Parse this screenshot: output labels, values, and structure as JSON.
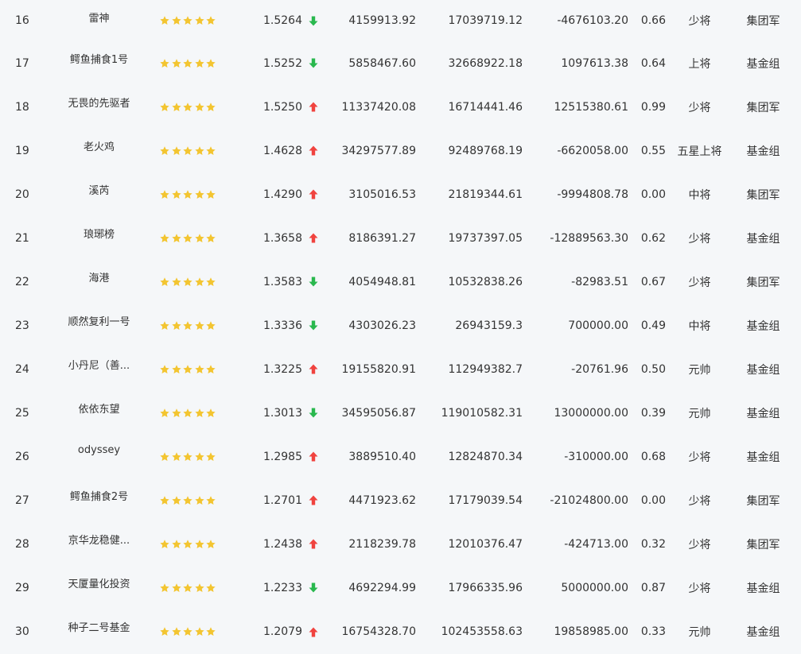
{
  "colors": {
    "star": "#f3c531",
    "arrow_up": "#f0433f",
    "arrow_down": "#29b84e",
    "background": "#f5f7f9",
    "text": "#333333"
  },
  "icons": {
    "rating": "star-icon",
    "up": "arrow-up-icon",
    "down": "arrow-down-icon"
  },
  "rows": [
    {
      "rank": "16",
      "name": "雷神",
      "stars": 5,
      "value": "1.5264",
      "trend": "down",
      "amount1": "4159913.92",
      "amount2": "17039719.12",
      "amount3": "-4676103.20",
      "ratio": "0.66",
      "level": "少将",
      "group": "集团军"
    },
    {
      "rank": "17",
      "name": "鳄鱼捕食1号",
      "stars": 5,
      "value": "1.5252",
      "trend": "down",
      "amount1": "5858467.60",
      "amount2": "32668922.18",
      "amount3": "1097613.38",
      "ratio": "0.64",
      "level": "上将",
      "group": "基金组"
    },
    {
      "rank": "18",
      "name": "无畏的先驱者",
      "stars": 5,
      "value": "1.5250",
      "trend": "up",
      "amount1": "11337420.08",
      "amount2": "16714441.46",
      "amount3": "12515380.61",
      "ratio": "0.99",
      "level": "少将",
      "group": "集团军"
    },
    {
      "rank": "19",
      "name": "老火鸡",
      "stars": 5,
      "value": "1.4628",
      "trend": "up",
      "amount1": "34297577.89",
      "amount2": "92489768.19",
      "amount3": "-6620058.00",
      "ratio": "0.55",
      "level": "五星上将",
      "group": "基金组"
    },
    {
      "rank": "20",
      "name": "溪芮",
      "stars": 5,
      "value": "1.4290",
      "trend": "up",
      "amount1": "3105016.53",
      "amount2": "21819344.61",
      "amount3": "-9994808.78",
      "ratio": "0.00",
      "level": "中将",
      "group": "集团军"
    },
    {
      "rank": "21",
      "name": "琅琊榜",
      "stars": 5,
      "value": "1.3658",
      "trend": "up",
      "amount1": "8186391.27",
      "amount2": "19737397.05",
      "amount3": "-12889563.30",
      "ratio": "0.62",
      "level": "少将",
      "group": "基金组"
    },
    {
      "rank": "22",
      "name": "海港",
      "stars": 5,
      "value": "1.3583",
      "trend": "down",
      "amount1": "4054948.81",
      "amount2": "10532838.26",
      "amount3": "-82983.51",
      "ratio": "0.67",
      "level": "少将",
      "group": "集团军"
    },
    {
      "rank": "23",
      "name": "顺然复利一号",
      "stars": 5,
      "value": "1.3336",
      "trend": "down",
      "amount1": "4303026.23",
      "amount2": "26943159.3",
      "amount3": "700000.00",
      "ratio": "0.49",
      "level": "中将",
      "group": "基金组"
    },
    {
      "rank": "24",
      "name": "小丹尼（善...",
      "stars": 5,
      "value": "1.3225",
      "trend": "up",
      "amount1": "19155820.91",
      "amount2": "112949382.7",
      "amount3": "-20761.96",
      "ratio": "0.50",
      "level": "元帅",
      "group": "基金组"
    },
    {
      "rank": "25",
      "name": "依依东望",
      "stars": 5,
      "value": "1.3013",
      "trend": "down",
      "amount1": "34595056.87",
      "amount2": "119010582.31",
      "amount3": "13000000.00",
      "ratio": "0.39",
      "level": "元帅",
      "group": "基金组"
    },
    {
      "rank": "26",
      "name": "odyssey",
      "stars": 5,
      "value": "1.2985",
      "trend": "up",
      "amount1": "3889510.40",
      "amount2": "12824870.34",
      "amount3": "-310000.00",
      "ratio": "0.68",
      "level": "少将",
      "group": "基金组"
    },
    {
      "rank": "27",
      "name": "鳄鱼捕食2号",
      "stars": 5,
      "value": "1.2701",
      "trend": "up",
      "amount1": "4471923.62",
      "amount2": "17179039.54",
      "amount3": "-21024800.00",
      "ratio": "0.00",
      "level": "少将",
      "group": "集团军"
    },
    {
      "rank": "28",
      "name": "京华龙稳健...",
      "stars": 5,
      "value": "1.2438",
      "trend": "up",
      "amount1": "2118239.78",
      "amount2": "12010376.47",
      "amount3": "-424713.00",
      "ratio": "0.32",
      "level": "少将",
      "group": "集团军"
    },
    {
      "rank": "29",
      "name": "天厦量化投资",
      "stars": 5,
      "value": "1.2233",
      "trend": "down",
      "amount1": "4692294.99",
      "amount2": "17966335.96",
      "amount3": "5000000.00",
      "ratio": "0.87",
      "level": "少将",
      "group": "基金组"
    },
    {
      "rank": "30",
      "name": "种子二号基金",
      "stars": 5,
      "value": "1.2079",
      "trend": "up",
      "amount1": "16754328.70",
      "amount2": "102453558.63",
      "amount3": "19858985.00",
      "ratio": "0.33",
      "level": "元帅",
      "group": "基金组"
    }
  ]
}
